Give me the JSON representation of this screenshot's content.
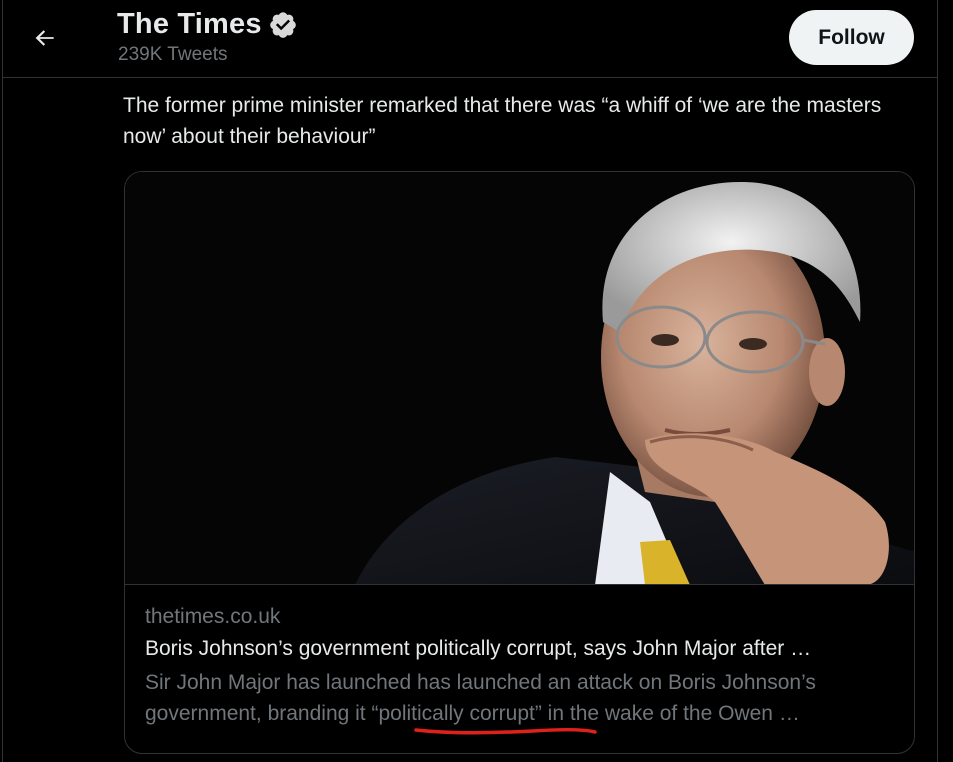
{
  "header": {
    "title": "The Times",
    "subtitle": "239K Tweets",
    "follow_label": "Follow"
  },
  "icons": {
    "back": "arrow-left-icon",
    "verified": "verified-badge-icon"
  },
  "colors": {
    "background": "#000000",
    "text_primary": "#e7e9ea",
    "text_secondary": "#71767b",
    "border": "#2f3336",
    "follow_bg": "#eff3f4",
    "annotation": "#e0201b"
  },
  "tweet": {
    "text": "The former prime minister remarked that there was “a whiff of ‘we are the masters now’ about their behaviour”"
  },
  "card": {
    "image_alt": "photo-of-man",
    "domain": "thetimes.co.uk",
    "headline": "Boris Johnson’s government politically corrupt, says John Major after …",
    "description_line1": "Sir John Major has launched has launched an attack on Boris Johnson’s",
    "description_line2": "government, branding it “politically corrupt” in the wake of the Owen …"
  }
}
